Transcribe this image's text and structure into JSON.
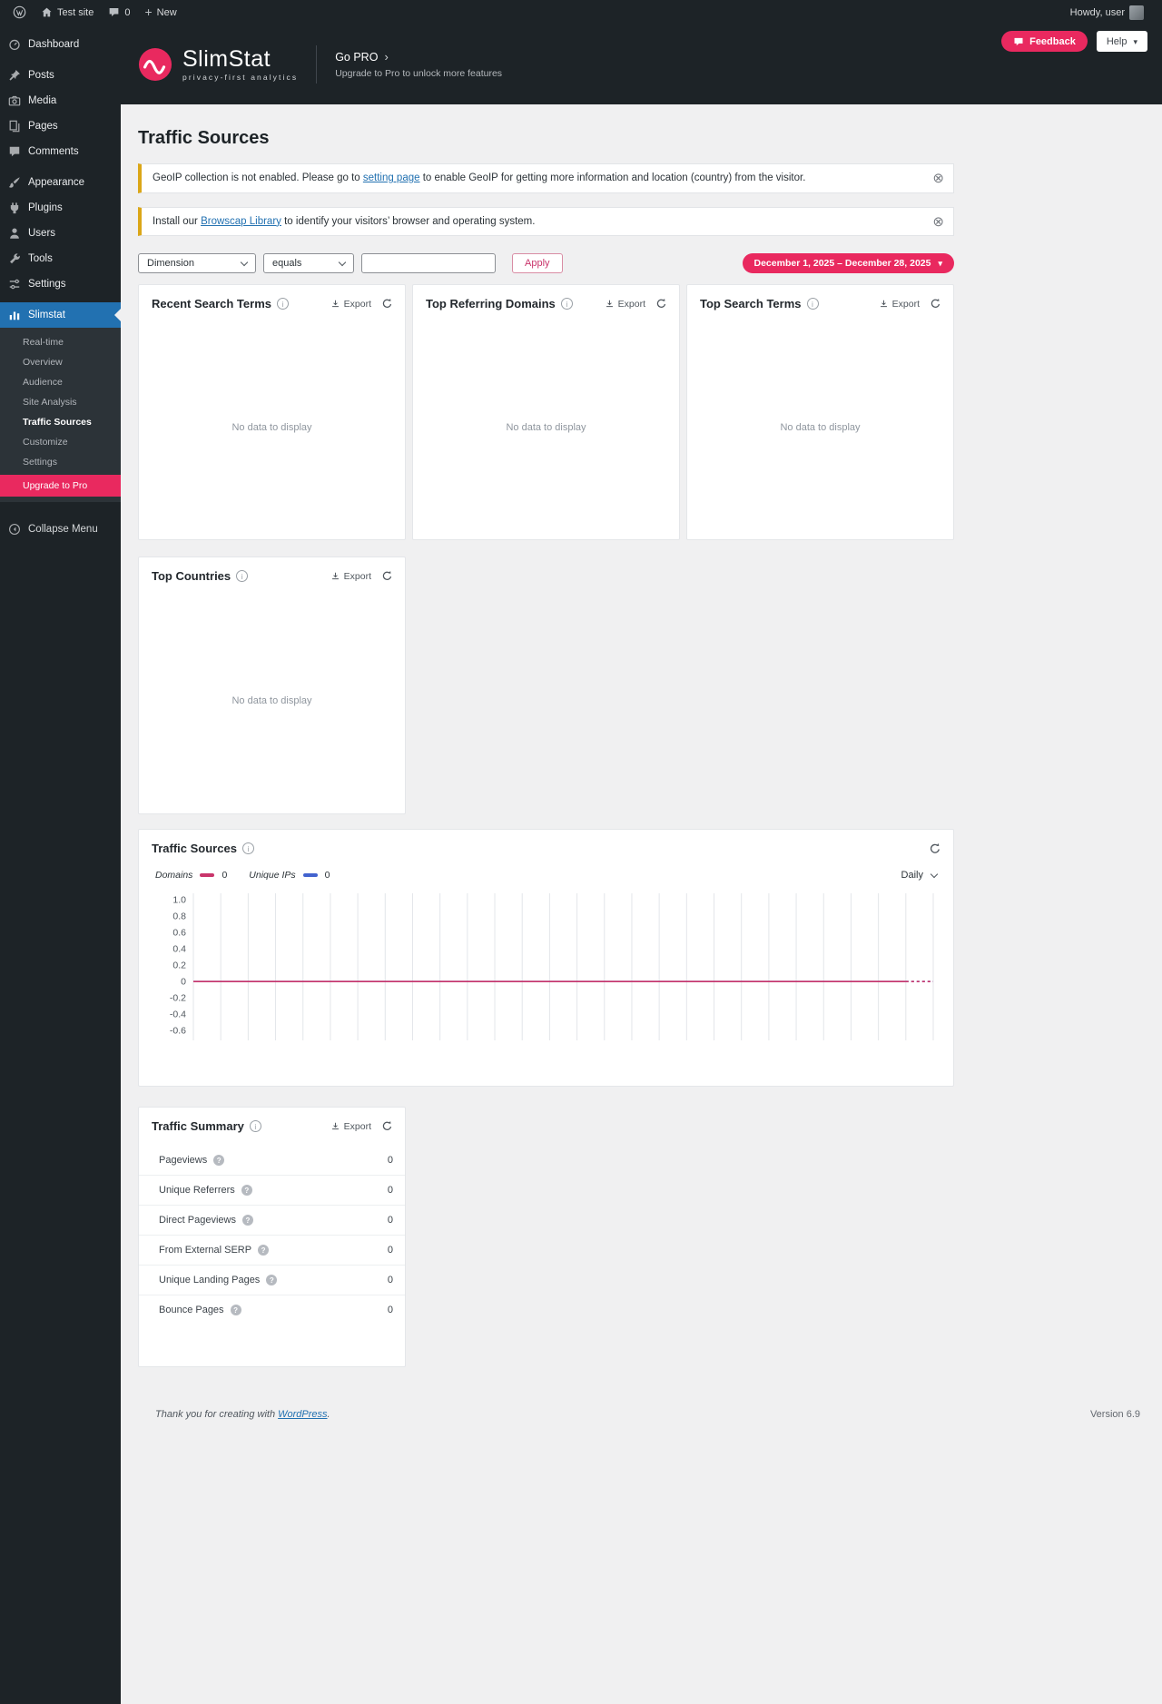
{
  "admin_bar": {
    "site_name": "Test site",
    "comments_count": "0",
    "new_label": "New",
    "howdy": "Howdy, user"
  },
  "sidebar": {
    "items": [
      "Dashboard",
      "Posts",
      "Media",
      "Pages",
      "Comments",
      "Appearance",
      "Plugins",
      "Users",
      "Tools",
      "Settings",
      "Slimstat"
    ],
    "submenu": [
      "Real-time",
      "Overview",
      "Audience",
      "Site Analysis",
      "Traffic Sources",
      "Customize",
      "Settings",
      "Upgrade to Pro"
    ],
    "collapse": "Collapse Menu"
  },
  "header": {
    "logo_title": "SlimStat",
    "logo_subtitle": "privacy-first analytics",
    "go_pro": "Go PRO",
    "go_pro_subtitle": "Upgrade to Pro to unlock more features",
    "feedback": "Feedback",
    "help": "Help"
  },
  "page": {
    "title": "Traffic Sources"
  },
  "notices": [
    {
      "before": "GeoIP collection is not enabled. Please go to ",
      "link": "setting page",
      "after": " to enable GeoIP for getting more information and location (country) from the visitor."
    },
    {
      "before": "Install our ",
      "link": "Browscap Library",
      "after": " to identify your visitors’ browser and operating system."
    }
  ],
  "filters": {
    "dimension": "Dimension",
    "operator": "equals",
    "value": "",
    "apply": "Apply",
    "date_range": "December 1, 2025 – December 28, 2025"
  },
  "panels": {
    "export": "Export",
    "no_data": "No data to display",
    "recent_search_terms": "Recent Search Terms",
    "top_referring_domains": "Top Referring Domains",
    "top_search_terms": "Top Search Terms",
    "top_countries": "Top Countries"
  },
  "chart_data": {
    "type": "line",
    "title": "Traffic Sources",
    "interval": "Daily",
    "x_count": 28,
    "x_range": [
      "December 1, 2025",
      "December 28, 2025"
    ],
    "grid": "vertical",
    "legend_position": "top-left",
    "ylim": [
      -0.72,
      1.08
    ],
    "dashed_tail_segments": 1,
    "yticks": [
      {
        "v": 1.0,
        "label": "1.0"
      },
      {
        "v": 0.8,
        "label": "0.8"
      },
      {
        "v": 0.6,
        "label": "0.6"
      },
      {
        "v": 0.4,
        "label": "0.4"
      },
      {
        "v": 0.2,
        "label": "0.2"
      },
      {
        "v": 0,
        "label": "0"
      },
      {
        "v": -0.2,
        "label": "-0.2"
      },
      {
        "v": -0.4,
        "label": "-0.4"
      },
      {
        "v": -0.6,
        "label": "-0.6"
      }
    ],
    "series": [
      {
        "name": "Domains",
        "color": "#c9356b",
        "display_total": "0",
        "values": [
          0,
          0,
          0,
          0,
          0,
          0,
          0,
          0,
          0,
          0,
          0,
          0,
          0,
          0,
          0,
          0,
          0,
          0,
          0,
          0,
          0,
          0,
          0,
          0,
          0,
          0,
          0,
          0
        ]
      },
      {
        "name": "Unique IPs",
        "color": "#4263cf",
        "display_total": "0",
        "values": [
          0,
          0,
          0,
          0,
          0,
          0,
          0,
          0,
          0,
          0,
          0,
          0,
          0,
          0,
          0,
          0,
          0,
          0,
          0,
          0,
          0,
          0,
          0,
          0,
          0,
          0,
          0,
          0
        ]
      }
    ]
  },
  "summary": {
    "title": "Traffic Summary",
    "rows": [
      {
        "label": "Pageviews",
        "value": "0"
      },
      {
        "label": "Unique Referrers",
        "value": "0"
      },
      {
        "label": "Direct Pageviews",
        "value": "0"
      },
      {
        "label": "From External SERP",
        "value": "0"
      },
      {
        "label": "Unique Landing Pages",
        "value": "0"
      },
      {
        "label": "Bounce Pages",
        "value": "0"
      }
    ]
  },
  "footer": {
    "before": "Thank you for creating with ",
    "link": "WordPress",
    "after": ".",
    "version": "Version 6.9"
  }
}
